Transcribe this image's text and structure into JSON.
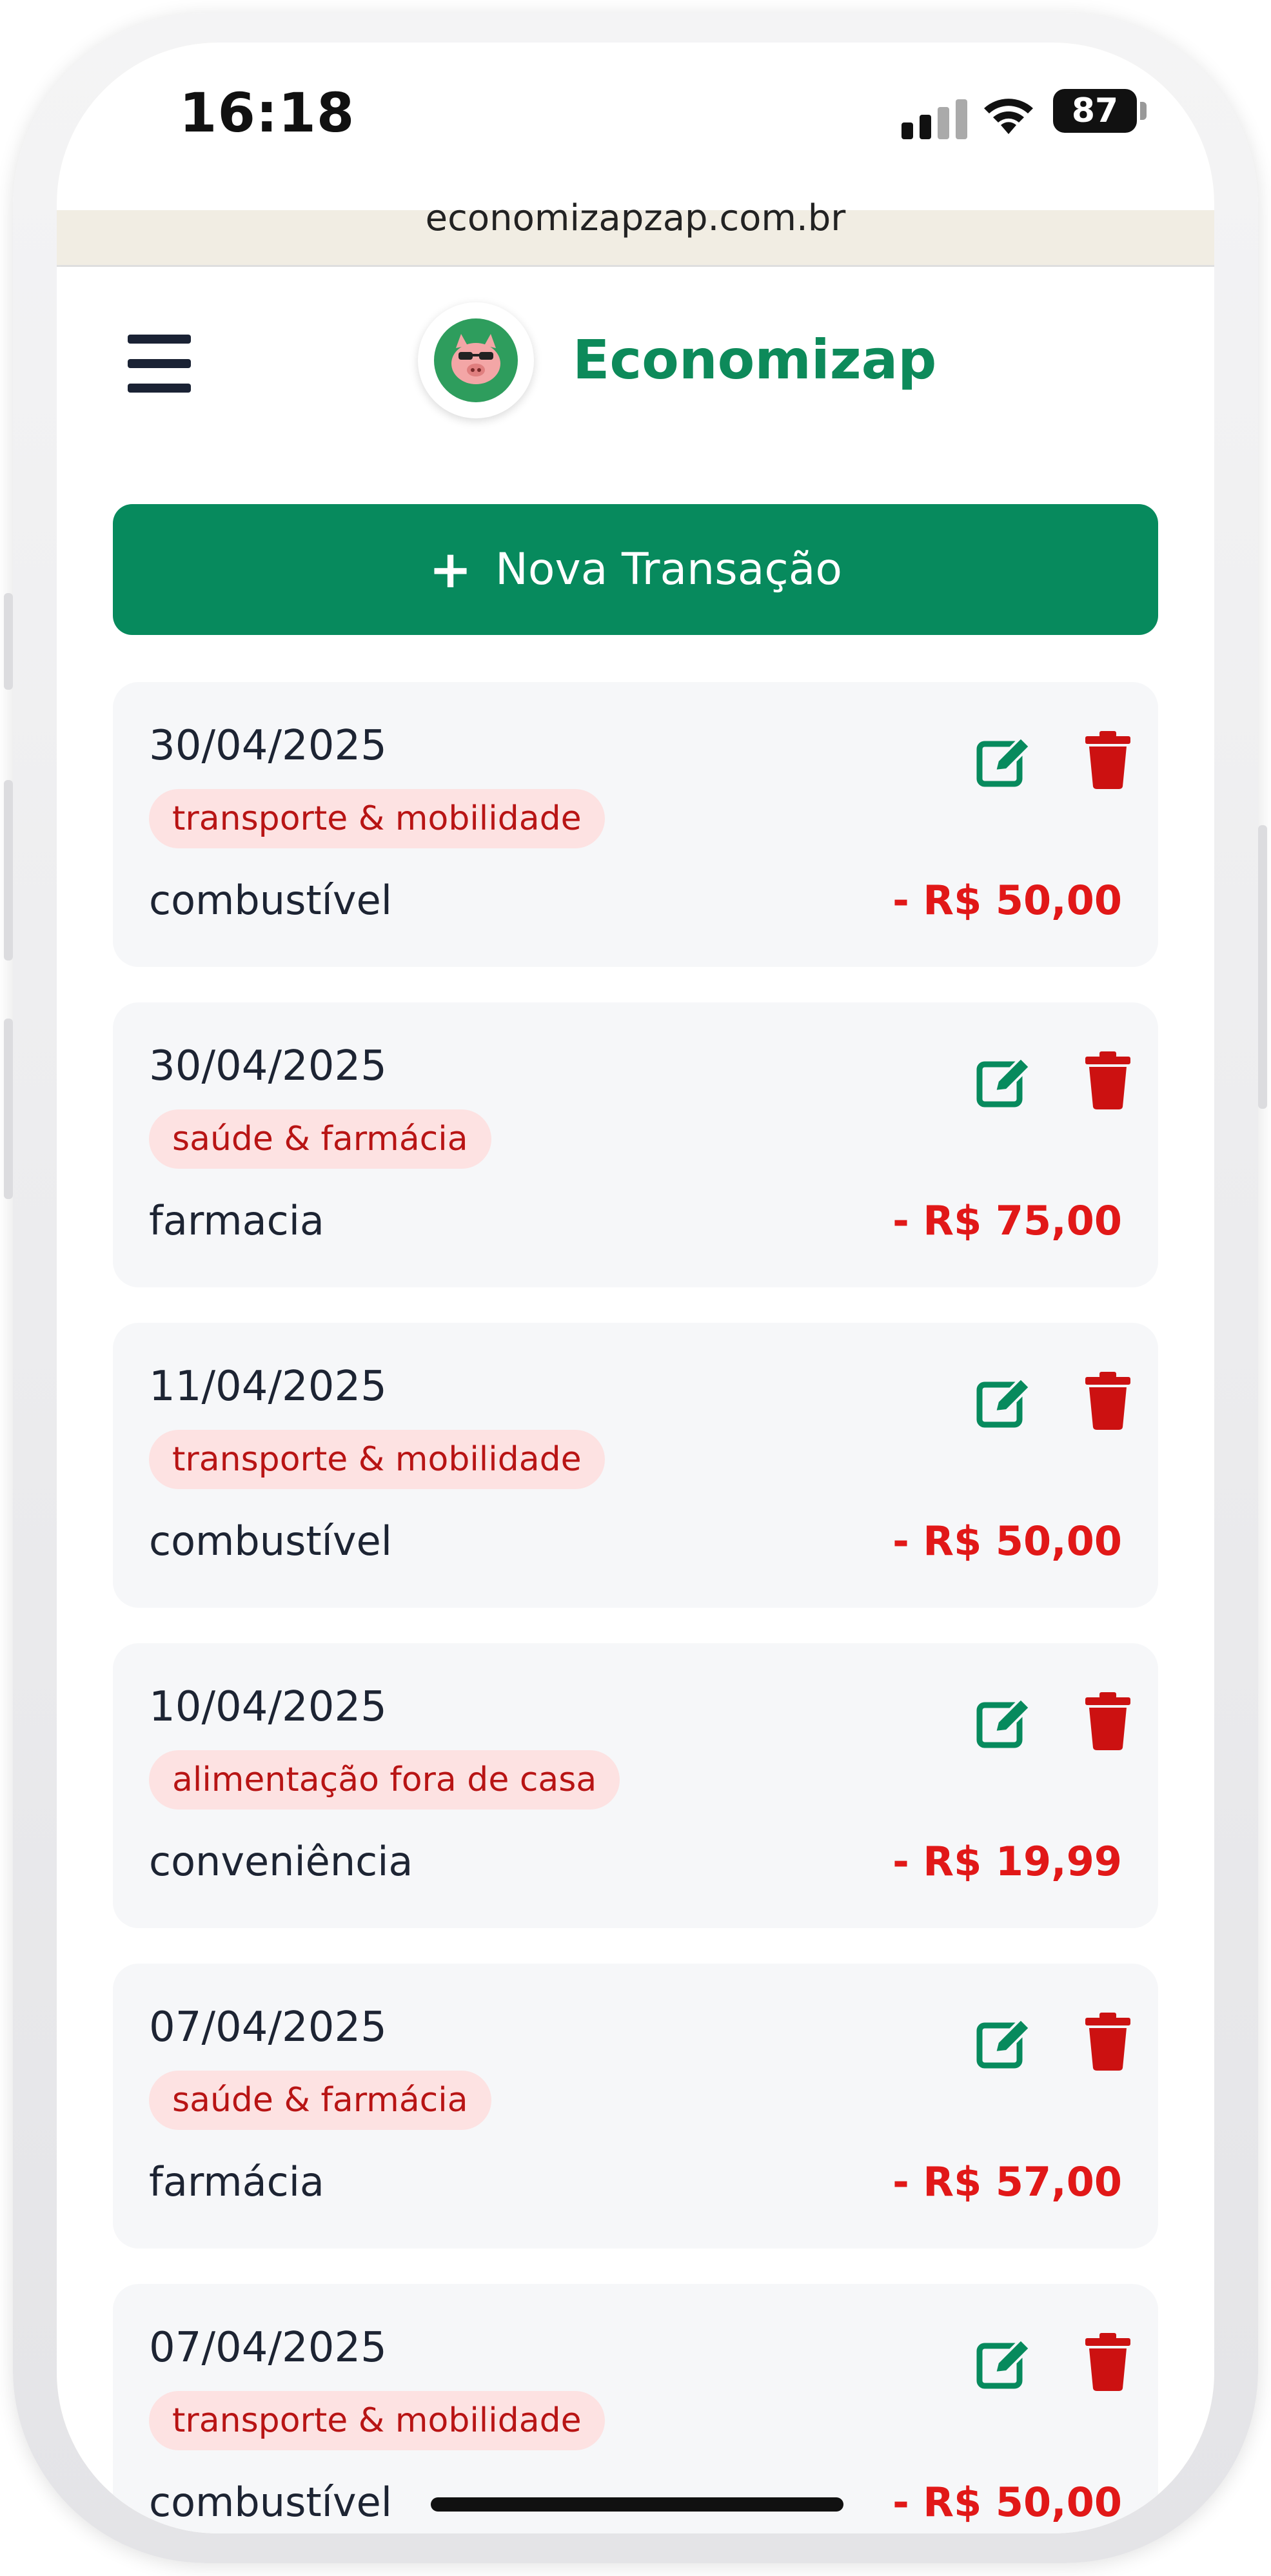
{
  "status_bar": {
    "time": "16:18",
    "battery": "87",
    "url": "economizapzap.com.br"
  },
  "header": {
    "app_name": "Economizap",
    "menu_icon": "hamburger-icon",
    "logo_icon": "pig-logo-icon"
  },
  "actions": {
    "new_transaction_label": "Nova Transação",
    "new_transaction_icon": "plus-icon"
  },
  "colors": {
    "brand_green": "#078a5d",
    "expense_red": "#e11818",
    "tag_bg": "#fde2e2",
    "tag_text": "#b81414"
  },
  "transactions": [
    {
      "date": "30/04/2025",
      "category": "transporte & mobilidade",
      "description": "combustível",
      "amount": "- R$ 50,00"
    },
    {
      "date": "30/04/2025",
      "category": "saúde & farmácia",
      "description": "farmacia",
      "amount": "- R$ 75,00"
    },
    {
      "date": "11/04/2025",
      "category": "transporte & mobilidade",
      "description": "combustível",
      "amount": "- R$ 50,00"
    },
    {
      "date": "10/04/2025",
      "category": "alimentação fora de casa",
      "description": "conveniência",
      "amount": "- R$ 19,99"
    },
    {
      "date": "07/04/2025",
      "category": "saúde & farmácia",
      "description": "farmácia",
      "amount": "- R$ 57,00"
    },
    {
      "date": "07/04/2025",
      "category": "transporte & mobilidade",
      "description": "combustível",
      "amount": "- R$ 50,00"
    }
  ]
}
